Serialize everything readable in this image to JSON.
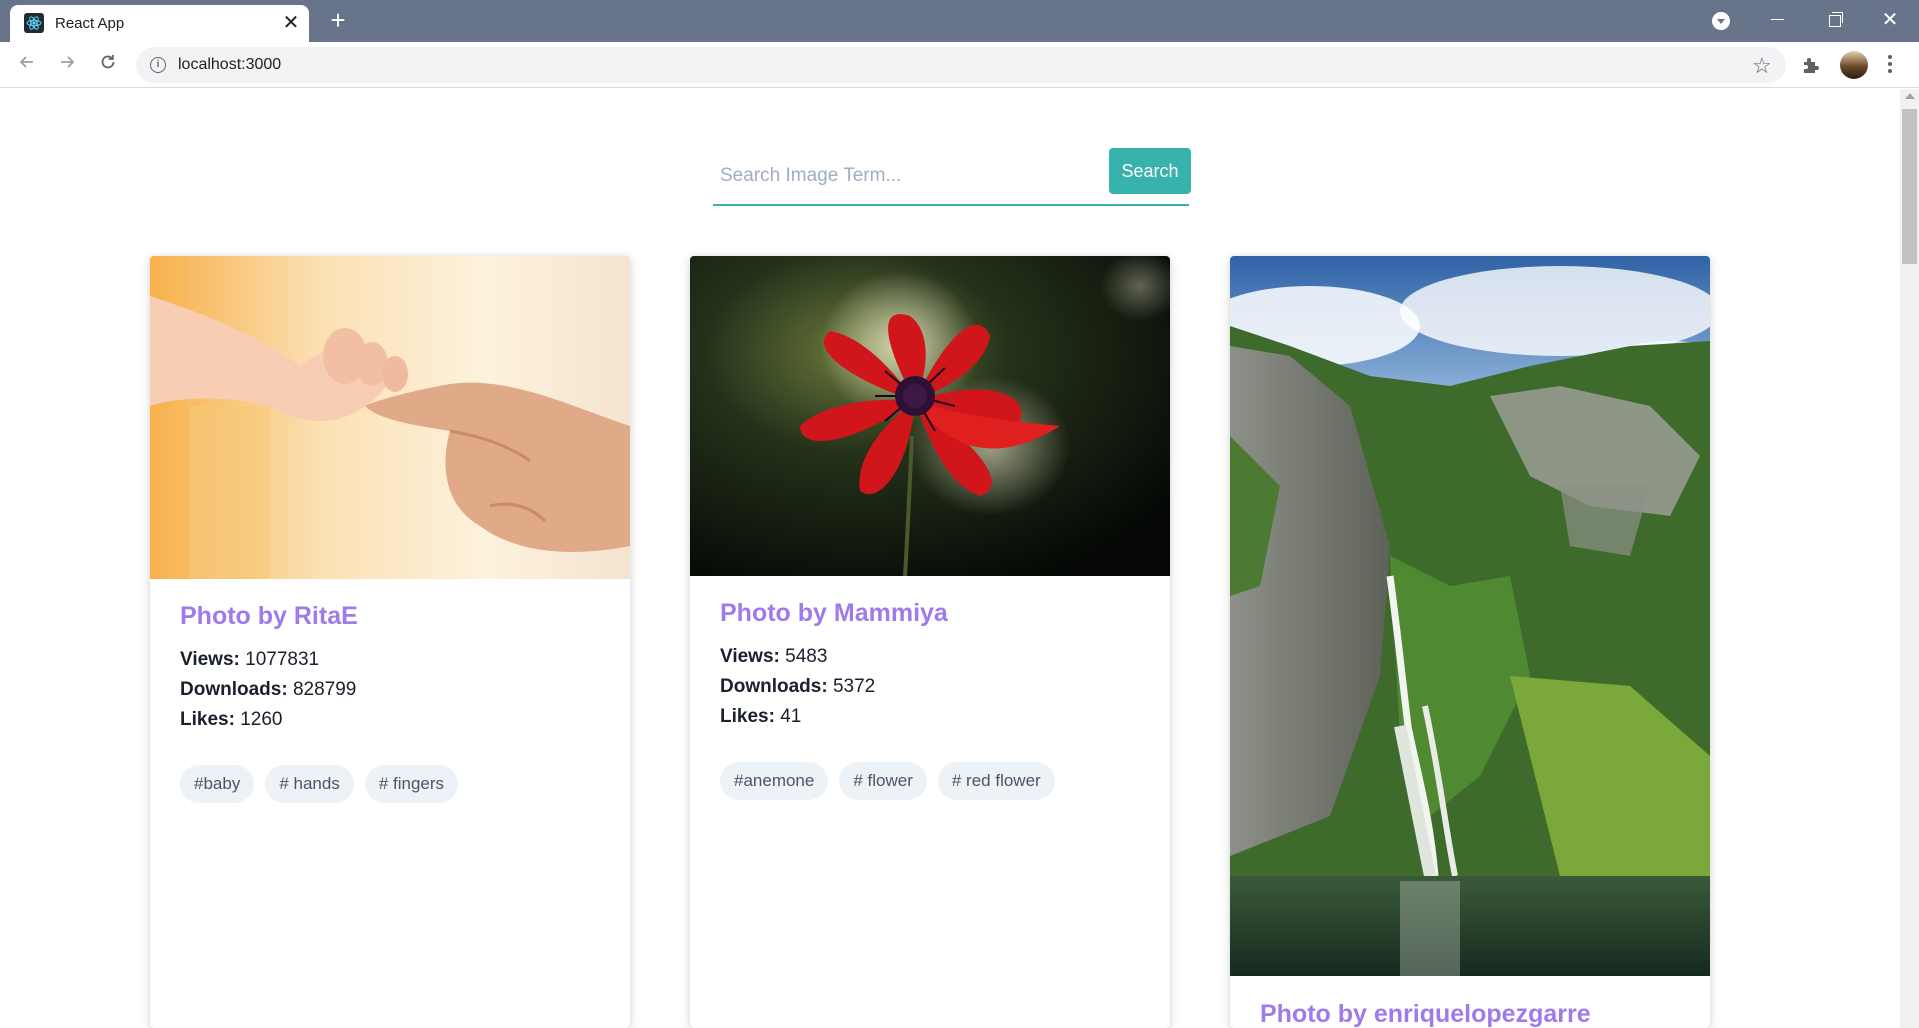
{
  "browser": {
    "tab_title": "React App",
    "url": "localhost:3000",
    "tab_close_glyph": "✕",
    "new_tab_glyph": "+",
    "window_close_glyph": "✕",
    "favicon": "react-icon",
    "colors": {
      "tabbar": "#677489",
      "accent": "#38b2ac",
      "title": "#9f7aea"
    }
  },
  "search": {
    "placeholder": "Search Image Term...",
    "value": "",
    "button_label": "Search"
  },
  "labels": {
    "views": "Views:",
    "downloads": "Downloads:",
    "likes": "Likes:"
  },
  "cards": [
    {
      "title": "Photo by RitaE",
      "views": "1077831",
      "downloads": "828799",
      "likes": "1260",
      "tags": [
        "#baby",
        "# hands",
        "# fingers"
      ],
      "image": "baby-hand-holding-finger"
    },
    {
      "title": "Photo by Mammiya",
      "views": "5483",
      "downloads": "5372",
      "likes": "41",
      "tags": [
        "#anemone",
        "# flower",
        "# red flower"
      ],
      "image": "red-anemone-flower"
    },
    {
      "title": "Photo by enriquelopezgarre",
      "image": "waterfall-fjord-cliffs"
    }
  ]
}
